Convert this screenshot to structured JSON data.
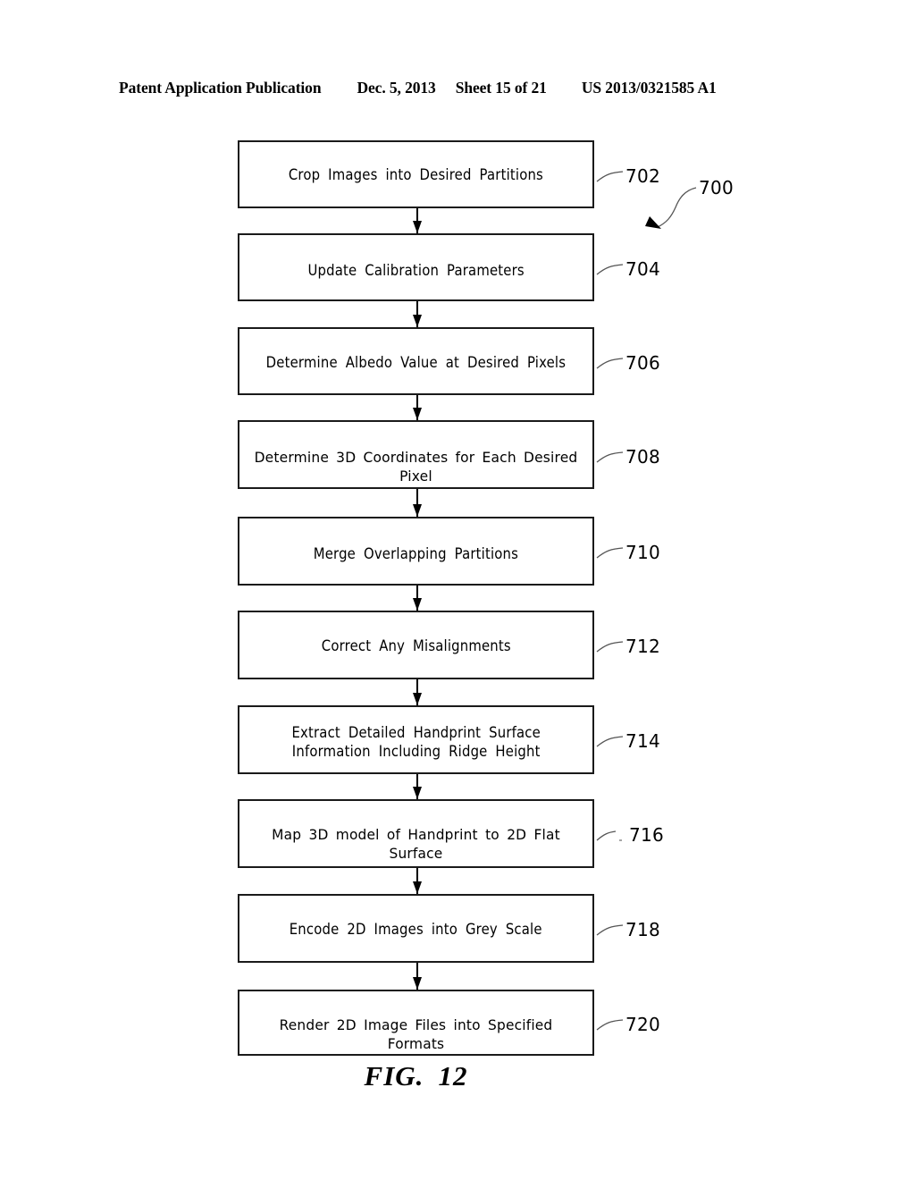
{
  "header": {
    "publication": "Patent Application Publication",
    "date": "Dec. 5, 2013",
    "sheet": "Sheet 15 of 21",
    "patent_number": "US 2013/0321585 A1"
  },
  "figure": {
    "caption_prefix": "FIG.",
    "caption_number": "12",
    "diagram_reference": "700"
  },
  "flowchart": {
    "type": "flowchart",
    "orientation": "top-to-bottom",
    "steps": [
      {
        "ref": "702",
        "text": "Crop Images into Desired Partitions"
      },
      {
        "ref": "704",
        "text": "Update Calibration Parameters"
      },
      {
        "ref": "706",
        "text": "Determine Albedo Value at Desired Pixels"
      },
      {
        "ref": "708",
        "text": "Determine 3D Coordinates for Each Desired Pixel"
      },
      {
        "ref": "710",
        "text": "Merge Overlapping Partitions"
      },
      {
        "ref": "712",
        "text": "Correct Any Misalignments"
      },
      {
        "ref": "714",
        "text": "Extract Detailed Handprint Surface\nInformation Including Ridge Height"
      },
      {
        "ref": "716",
        "text": "Map 3D model of Handprint to 2D Flat Surface"
      },
      {
        "ref": "718",
        "text": "Encode 2D Images into Grey Scale"
      },
      {
        "ref": "720",
        "text": "Render 2D Image Files into Specified Formats"
      }
    ]
  }
}
